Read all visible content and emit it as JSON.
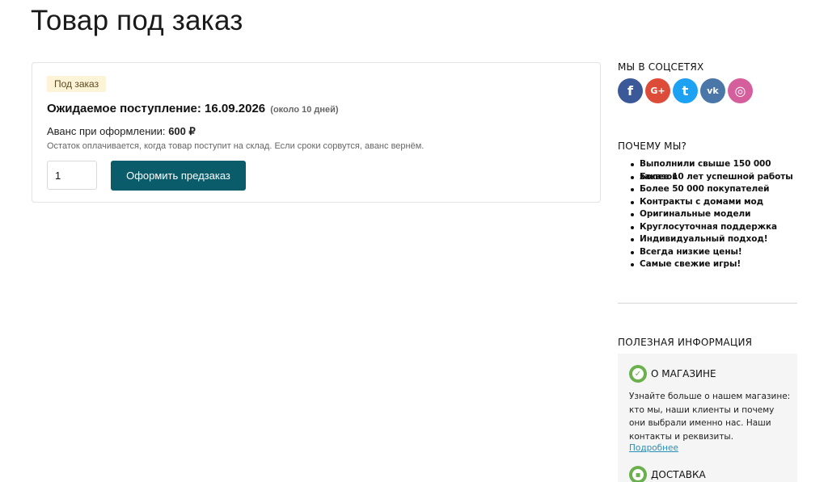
{
  "page": {
    "title": "Товар под заказ"
  },
  "preorder": {
    "badge": "Под заказ",
    "eta_label": "Ожидаемое поступление: 16.09.2026",
    "eta_note": "(около 10 дней)",
    "advance_label": "Аванс при оформлении:",
    "advance_value": "600 ₽",
    "remainder_text": "Остаток оплачивается, когда товар поступит на склад. Если сроки сорвутся, аванс вернём.",
    "quantity": "1",
    "button_label": "Оформить предзаказ",
    "accent_color": "#0b5c6b"
  },
  "sidebar": {
    "social": {
      "heading": "МЫ В СОЦСЕТЯХ",
      "icons": [
        {
          "name": "facebook-icon",
          "glyph": "f",
          "color": "#3b5998"
        },
        {
          "name": "google-plus-icon",
          "glyph": "G+",
          "color": "#dd4b39"
        },
        {
          "name": "twitter-icon",
          "glyph": "t",
          "color": "#1da1f2"
        },
        {
          "name": "vk-icon",
          "glyph": "vk",
          "color": "#4a76a8"
        },
        {
          "name": "instagram-icon",
          "glyph": "◎",
          "color": "#d55f9c"
        }
      ]
    },
    "why": {
      "heading": "ПОЧЕМУ МЫ?",
      "items": [
        "Выполнили свыше 150 000 заказов",
        "Более 10 лет успешной работы",
        "Более 50 000 покупателей",
        "Контракты с домами мод",
        "Оригинальные модели",
        "Круглосуточная поддержка",
        "Индивидуальный подход!",
        "Всегда низкие цены!",
        "Самые свежие игры!"
      ]
    },
    "useful": {
      "heading": "ПОЛЕЗНАЯ ИНФОРМАЦИЯ",
      "about_title": "О МАГАЗИНЕ",
      "about_text": "Узнайте больше о нашем магазине: кто мы, наши клиенты и почему они выбрали именно нас. Наши контакты и реквизиты.",
      "about_link": "Подробнее",
      "delivery_title": "ДОСТАВКА"
    }
  }
}
